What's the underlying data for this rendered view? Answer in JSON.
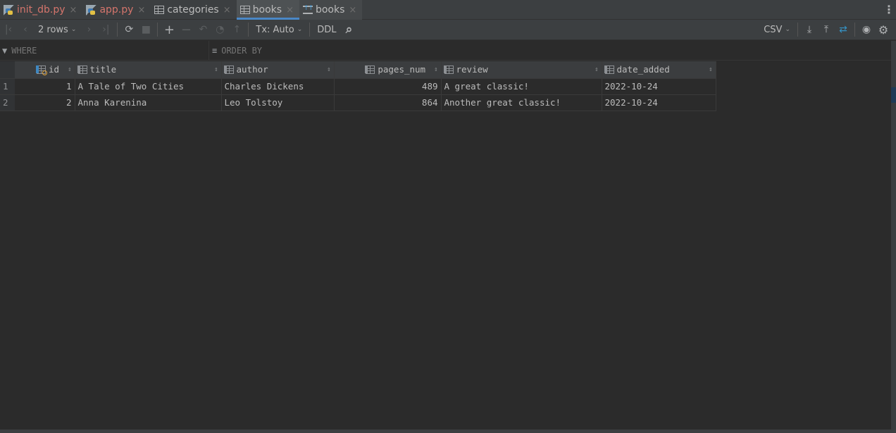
{
  "tabs": [
    {
      "label": "init_db.py",
      "icon": "python-file-icon",
      "modified": true,
      "active": false
    },
    {
      "label": "app.py",
      "icon": "python-file-icon",
      "modified": true,
      "active": false
    },
    {
      "label": "categories",
      "icon": "table-icon",
      "modified": false,
      "active": false
    },
    {
      "label": "books",
      "icon": "table-icon",
      "modified": false,
      "active": true
    },
    {
      "label": "books",
      "icon": "ddl-icon",
      "modified": false,
      "active": false
    }
  ],
  "tab_close_glyph": "×",
  "more_glyph": "⋮",
  "toolbar": {
    "first_glyph": "|‹",
    "prev_glyph": "‹",
    "rows_label": "2 rows",
    "next_glyph": "›",
    "last_glyph": "›|",
    "refresh_glyph": "⟳",
    "stop_glyph": "■",
    "add_glyph": "+",
    "remove_glyph": "−",
    "revert_glyph": "↶",
    "preview_glyph": "◔",
    "submit_glyph": "↑",
    "tx_label": "Tx: Auto",
    "ddl_label": "DDL",
    "search_glyph": "⌕",
    "export_format": "CSV",
    "export_glyph": "⤓",
    "import_glyph": "⤒",
    "compare_glyph": "⇄",
    "view_glyph": "◉",
    "settings_glyph": "⚙",
    "chevron_glyph": "⌄"
  },
  "filter": {
    "where_placeholder": "WHERE",
    "order_placeholder": "ORDER BY",
    "where_glyph": "▼",
    "order_glyph": "≡"
  },
  "grid": {
    "sort_glyph": "⇕",
    "columns": [
      {
        "name": "id",
        "pk": true,
        "align": "right"
      },
      {
        "name": "title",
        "pk": false,
        "align": "left"
      },
      {
        "name": "author",
        "pk": false,
        "align": "left"
      },
      {
        "name": "pages_num",
        "pk": false,
        "align": "right"
      },
      {
        "name": "review",
        "pk": false,
        "align": "left"
      },
      {
        "name": "date_added",
        "pk": false,
        "align": "left"
      }
    ],
    "rows": [
      {
        "num": "1",
        "cells": [
          "1",
          "A Tale of Two Cities",
          "Charles Dickens",
          "489",
          "A great classic!",
          "2022-10-24"
        ]
      },
      {
        "num": "2",
        "cells": [
          "2",
          "Anna Karenina",
          "Leo Tolstoy",
          "864",
          "Another great classic!",
          "2022-10-24"
        ]
      }
    ]
  },
  "colors": {
    "accent": "#4a88c7",
    "modified_tab": "#d5756c",
    "background": "#2b2b2b"
  }
}
